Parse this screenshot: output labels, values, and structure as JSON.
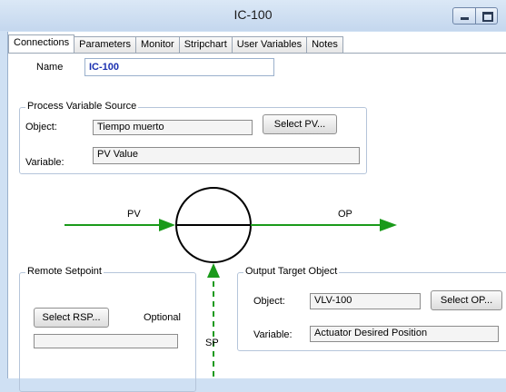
{
  "window": {
    "title": "IC-100"
  },
  "tabs": [
    "Connections",
    "Parameters",
    "Monitor",
    "Stripchart",
    "User Variables",
    "Notes"
  ],
  "name": {
    "label": "Name",
    "value": "IC-100"
  },
  "pv_source": {
    "legend": "Process Variable Source",
    "object_label": "Object:",
    "object_value": "Tiempo muerto",
    "select_button": "Select PV...",
    "variable_label": "Variable:",
    "variable_value": "PV Value"
  },
  "diagram": {
    "pv_label": "PV",
    "op_label": "OP",
    "sp_label": "SP",
    "arrow_color": "#1a9a1a"
  },
  "remote_setpoint": {
    "legend": "Remote Setpoint",
    "select_button": "Select RSP...",
    "optional_label": "Optional",
    "value": ""
  },
  "output_target": {
    "legend": "Output Target Object",
    "object_label": "Object:",
    "object_value": "VLV-100",
    "select_button": "Select OP...",
    "variable_label": "Variable:",
    "variable_value": "Actuator Desired Position"
  }
}
